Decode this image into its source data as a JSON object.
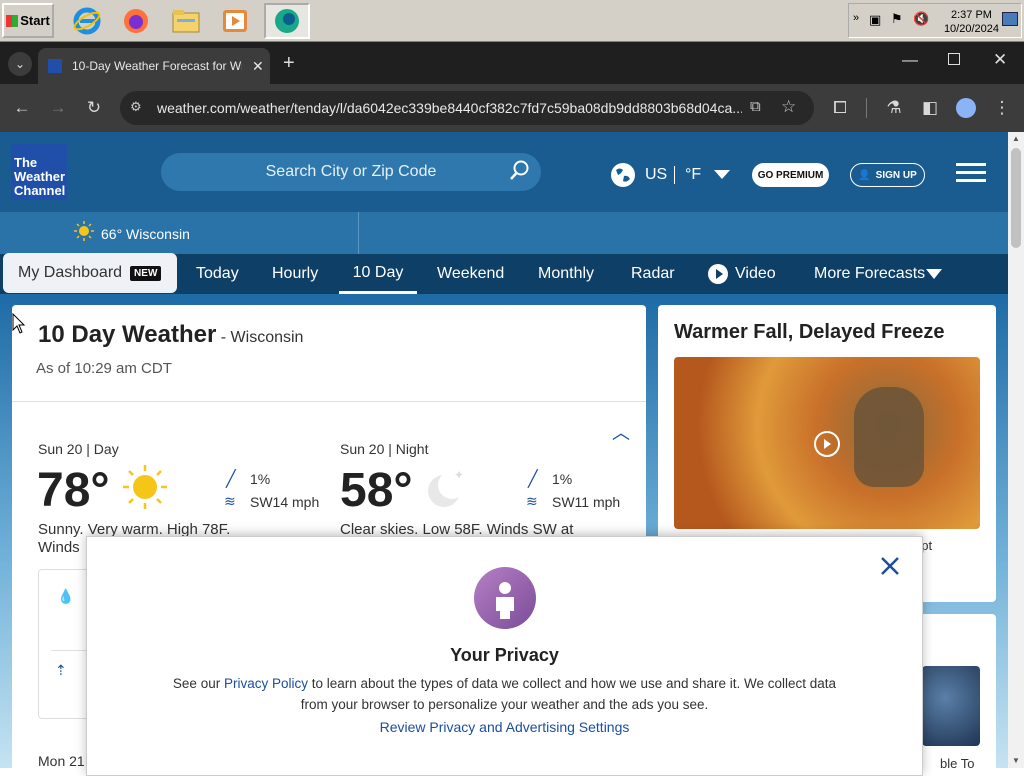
{
  "taskbar": {
    "start_label": "Start",
    "clock_time": "2:37 PM",
    "clock_date": "10/20/2024"
  },
  "browser": {
    "tab_title": "10-Day Weather Forecast for Wisco",
    "url": "weather.com/weather/tenday/l/da6042ec339be8440cf382c7fd7c59ba08db9dd8803b68d04ca..."
  },
  "header": {
    "logo_lines": [
      "The",
      "Weather",
      "Channel"
    ],
    "search_placeholder": "Search City or Zip Code",
    "region": "US",
    "unit": "°F",
    "premium_label": "GO PREMIUM",
    "signup_label": "SIGN UP"
  },
  "location_bar": {
    "temp_location": "66° Wisconsin"
  },
  "nav": {
    "dashboard_label": "My Dashboard",
    "new_badge": "NEW",
    "items": [
      "Today",
      "Hourly",
      "10 Day",
      "Weekend",
      "Monthly",
      "Radar",
      "Video",
      "More Forecasts"
    ]
  },
  "forecast": {
    "title": "10 Day Weather",
    "location": "- Wisconsin",
    "as_of": "As of 10:29 am CDT",
    "day": {
      "heading_date": "Sun 20",
      "heading_part": "| Day",
      "temp": "78°",
      "precip": "1%",
      "wind": "SW14 mph",
      "desc_line1": "Sunny. Very warm. High 78F.",
      "desc_line2": "Winds"
    },
    "night": {
      "heading_date": "Sun 20",
      "heading_part": "| Night",
      "temp": "58°",
      "precip": "1%",
      "wind": "SW11 mph",
      "desc_line1": "Clear skies. Low 58F. Winds SW at"
    },
    "next_day": "Mon 21"
  },
  "sidebar": {
    "article_title": "Warmer Fall, Delayed Freeze",
    "caption_fragment": "upt",
    "second_fragment": "ble To"
  },
  "privacy_modal": {
    "title": "Your Privacy",
    "body_prefix": "See our ",
    "policy_link": "Privacy Policy",
    "body_line1_rest": " to learn about the types of data we collect and how we use and share it. We collect data",
    "body_line2": "from your browser to personalize your weather and the ads you see.",
    "settings_link": "Review Privacy and Advertising Settings"
  },
  "colors": {
    "header_blue": "#1a5c90",
    "nav_dark": "#0e3f66",
    "link_blue": "#1b4ea3",
    "sun_yellow": "#f5c518"
  }
}
